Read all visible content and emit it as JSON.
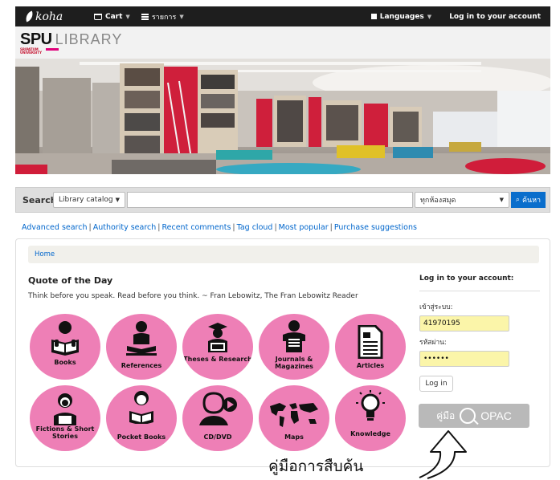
{
  "nav": {
    "brand": "koha",
    "cart": "Cart",
    "lists": "รายการ",
    "languages": "Languages",
    "login": "Log in to your account"
  },
  "header": {
    "logo_main": "SPU",
    "logo_secondary": "LIBRARY",
    "logo_sub": "SRIPATUM UNIVERSITY"
  },
  "search": {
    "label": "Search",
    "catalog_select": "Library catalog",
    "query": "",
    "library_select": "ทุกห้องสมุด",
    "button": "ค้นหา"
  },
  "links": [
    "Advanced search",
    "Authority search",
    "Recent comments",
    "Tag cloud",
    "Most popular",
    "Purchase suggestions"
  ],
  "breadcrumb": "Home",
  "quote": {
    "title": "Quote of the Day",
    "text": "Think before you speak. Read before you think. ~ Fran Lebowitz, The Fran Lebowitz Reader"
  },
  "categories": [
    {
      "label": "Books",
      "icon": "book-reader-icon"
    },
    {
      "label": "References",
      "icon": "reference-reader-icon"
    },
    {
      "label": "Theses & Research",
      "icon": "graduate-icon"
    },
    {
      "label": "Journals & Magazines",
      "icon": "magazine-reader-icon"
    },
    {
      "label": "Articles",
      "icon": "document-icon"
    },
    {
      "label": "Fictions & Short Stories",
      "icon": "girl-reader-icon"
    },
    {
      "label": "Pocket Books",
      "icon": "child-reader-icon"
    },
    {
      "label": "CD/DVD",
      "icon": "person-play-icon"
    },
    {
      "label": "Maps",
      "icon": "world-map-icon"
    },
    {
      "label": "Knowledge",
      "icon": "lightbulb-icon"
    }
  ],
  "login": {
    "title": "Log in to your account:",
    "username_label": "เข้าสู่ระบบ:",
    "username_value": "41970195",
    "password_label": "รหัสผ่าน:",
    "password_value": "••••••",
    "button": "Log in"
  },
  "opac": {
    "prefix": "คู่มือ",
    "suffix": "OPAC"
  },
  "caption": "คู่มือการสืบค้น",
  "colors": {
    "navbar": "#1e1e1e",
    "category_circle": "#ee7fb6",
    "search_button": "#0a6ecc",
    "input_highlight": "#fbf5a9",
    "link": "#0066cc"
  }
}
